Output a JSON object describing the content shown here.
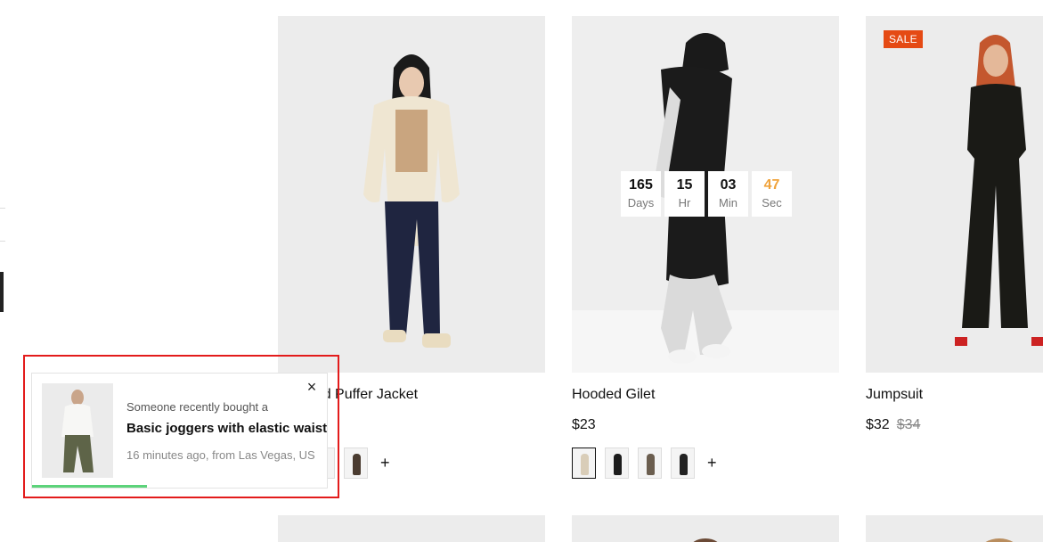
{
  "products": [
    {
      "title": "Collared Puffer Jacket",
      "price": "",
      "old_price": "",
      "swatches": [
        {
          "color": "#2b2b2b",
          "active": false
        },
        {
          "color": "#3a3a3a",
          "active": false
        },
        {
          "color": "#4a3b30",
          "active": false
        }
      ],
      "swatch_more": "+"
    },
    {
      "title": "Hooded Gilet",
      "price": "$23",
      "old_price": "",
      "swatches": [
        {
          "color": "#d9cdb8",
          "active": true
        },
        {
          "color": "#1c1c1c",
          "active": false
        },
        {
          "color": "#6b5e4f",
          "active": false
        },
        {
          "color": "#222222",
          "active": false
        }
      ],
      "swatch_more": "+",
      "countdown": [
        {
          "value": "165",
          "label": "Days"
        },
        {
          "value": "15",
          "label": "Hr"
        },
        {
          "value": "03",
          "label": "Min"
        },
        {
          "value": "47",
          "label": "Sec"
        }
      ]
    },
    {
      "title": "Jumpsuit",
      "price": "$32",
      "old_price": "$34",
      "badge": "SALE"
    }
  ],
  "popup": {
    "pre_text": "Someone recently bought a",
    "product_name": "Basic joggers with elastic waist",
    "time_location": "16 minutes ago, from Las Vegas, US",
    "close_icon": "×",
    "progress": 0.39
  },
  "colors": {
    "sale_badge": "#e54a14",
    "countdown_seconds": "#f0a33b",
    "progress_bar": "#5cd37a",
    "highlight_outline": "#e31b1b"
  }
}
